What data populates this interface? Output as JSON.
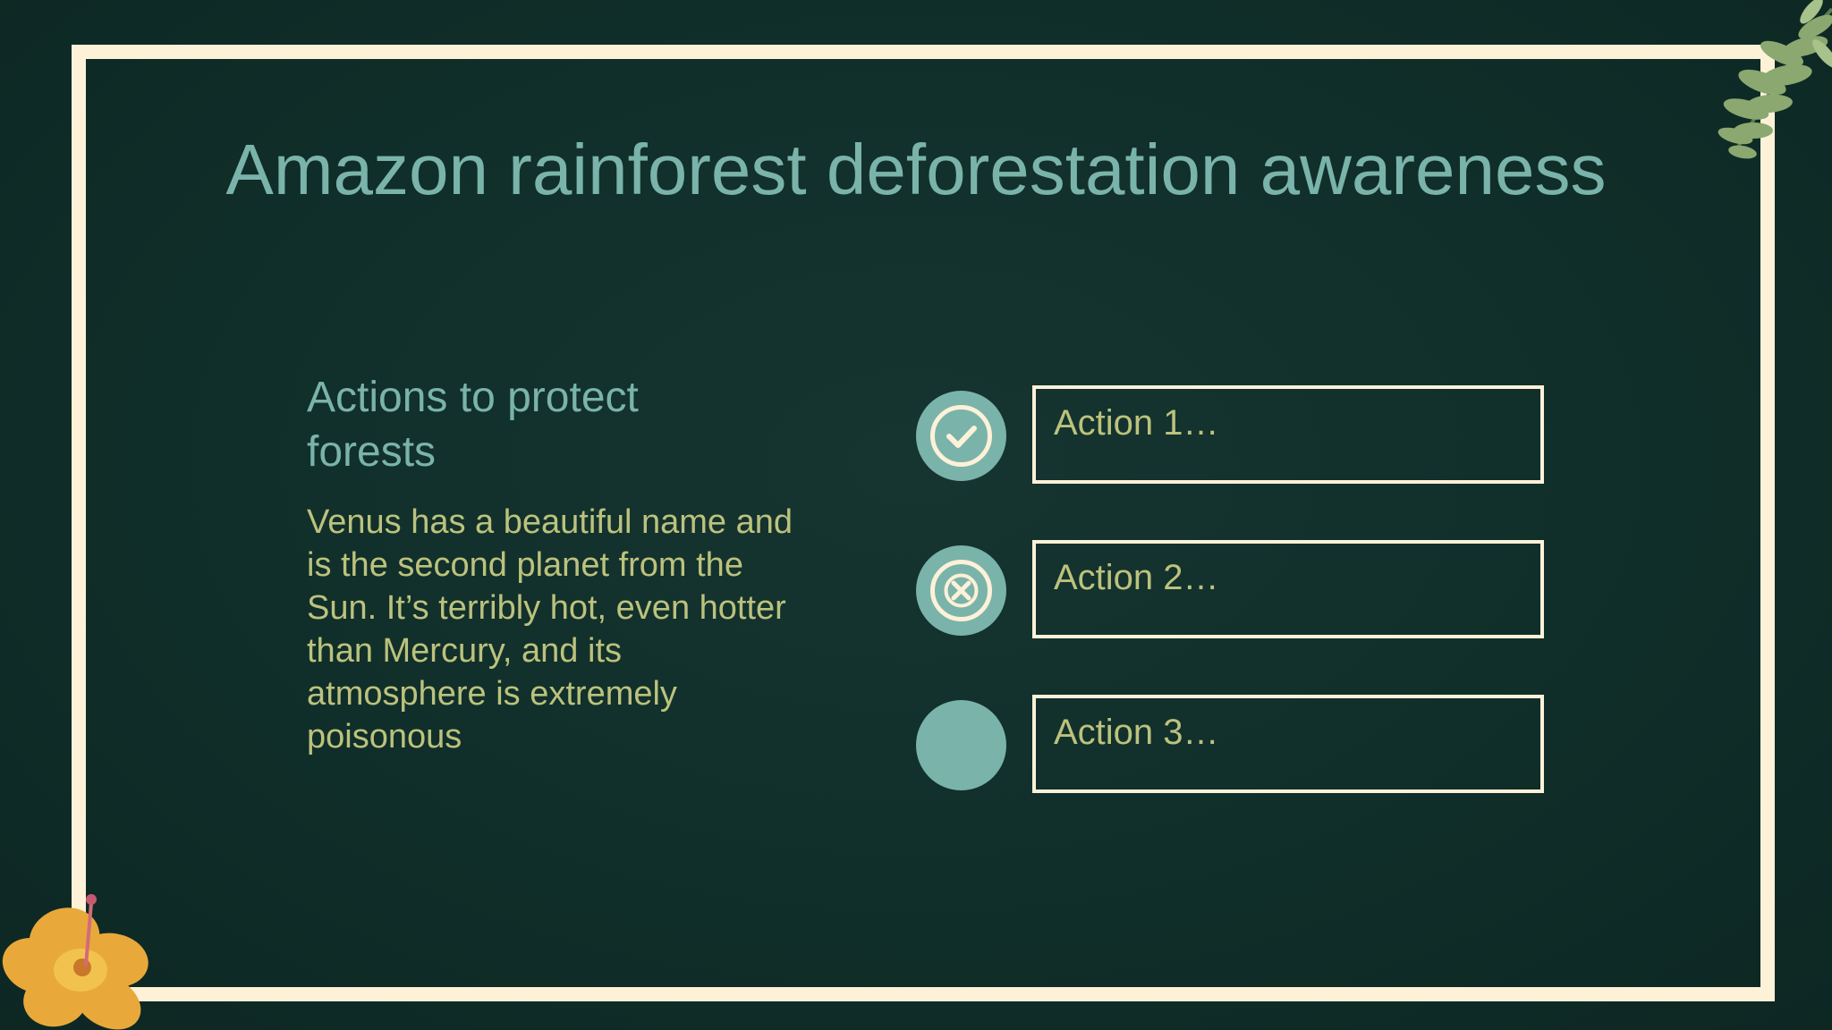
{
  "slide": {
    "title": "Amazon rainforest deforestation awareness",
    "section": {
      "heading": "Actions to protect forests",
      "body": "Venus has a beautiful name and is the second planet from the Sun. It’s terribly hot, even hotter than Mercury, and its atmosphere is extremely poisonous"
    },
    "actions": [
      {
        "label": "Action 1…",
        "icon": "check-circle-icon"
      },
      {
        "label": "Action 2…",
        "icon": "x-circle-icon"
      },
      {
        "label": "Action 3…",
        "icon": "blank-circle"
      }
    ]
  },
  "decorations": {
    "top_right": "fern-leaves",
    "bottom_left": "yellow-hibiscus-flower"
  },
  "colors": {
    "background": "#11302b",
    "frame": "#fdf1d8",
    "title_teal": "#7ab3aa",
    "body_olive": "#bcc27d",
    "circle_fill": "#7ab3aa"
  }
}
